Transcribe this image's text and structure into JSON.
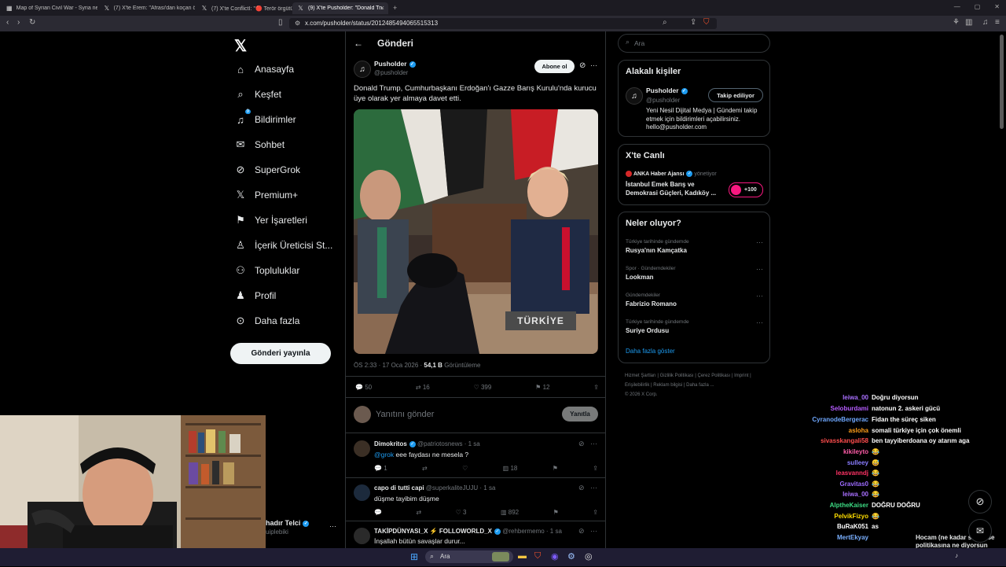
{
  "browser": {
    "tabs": [
      {
        "label": "Map of Syrian Civil War - Syria news ...",
        "icon": "map-icon"
      },
      {
        "label": "(7) X'te Erem: \"Afrasi'dan koçan örgüt...",
        "icon": "x-icon"
      },
      {
        "label": "(7) X'te ConflictI: \"🔴 Terör örgütü P...",
        "icon": "x-icon"
      },
      {
        "label": "(9) X'te Pusholder: \"Donald Trum...",
        "icon": "x-icon"
      }
    ],
    "url": "x.com/pusholder/status/2012485494065515313"
  },
  "sidebar": {
    "items": [
      {
        "label": "Anasayfa",
        "icon": "home-icon"
      },
      {
        "label": "Keşfet",
        "icon": "search-icon"
      },
      {
        "label": "Bildirimler",
        "icon": "bell-icon",
        "badge": "9"
      },
      {
        "label": "Sohbet",
        "icon": "mail-icon"
      },
      {
        "label": "SuperGrok",
        "icon": "grok-icon"
      },
      {
        "label": "Premium+",
        "icon": "x-icon"
      },
      {
        "label": "Yer İşaretleri",
        "icon": "bookmark-icon"
      },
      {
        "label": "İçerik Üreticisi St...",
        "icon": "creator-icon"
      },
      {
        "label": "Topluluklar",
        "icon": "community-icon"
      },
      {
        "label": "Profil",
        "icon": "profile-icon"
      },
      {
        "label": "Daha fazla",
        "icon": "more-icon"
      }
    ],
    "post_button": "Gönderi yayınla",
    "account_name": "hadır Telci",
    "account_handle": "uiplebiki"
  },
  "main": {
    "header": "Gönderi",
    "post": {
      "author": "Pusholder",
      "handle": "@pusholder",
      "follow_label": "Abone ol",
      "text": "Donald Trump, Cumhurbaşkanı Erdoğan'ı Gazze Barış Kurulu'nda kurucu üye olarak yer almaya davet etti.",
      "image_caption": "TÜRKİYE",
      "time": "ÖS 2:33 · 17 Oca 2026 · ",
      "views": "54,1 B",
      "views_label": " Görüntüleme",
      "stats": {
        "replies": "50",
        "reposts": "16",
        "likes": "399",
        "bookmarks": "12"
      }
    },
    "reply_box": {
      "placeholder": "Yanıtını gönder",
      "button": "Yanıtla"
    },
    "replies": [
      {
        "author": "Dimokritos",
        "handle": "@patriotosnews · 1 sa",
        "mention": "@grok",
        "text": " eee faydası ne mesela ?",
        "replies": "1",
        "likes": "",
        "views": "18"
      },
      {
        "author": "capo di tutti capi",
        "handle": "@superkaliteJUJU · 1 sa",
        "mention": "",
        "text": "düşme tayibim düşme",
        "replies": "",
        "likes": "3",
        "views": "892"
      },
      {
        "author": "TAKİPDÜNYASI_X ⚡ FOLLOWORLD_X",
        "handle": "@rehbermemo · 1 sa",
        "mention": "",
        "text": "İnşallah bütün savaşlar durur...",
        "replies": "",
        "likes": "",
        "views": ""
      }
    ]
  },
  "right": {
    "search_placeholder": "Ara",
    "related": {
      "title": "Alakalı kişiler",
      "name": "Pusholder",
      "handle": "@pusholder",
      "follow_label": "Takip ediliyor",
      "bio": "Yeni Nesil Dijital Medya | Gündemi takip etmek için bildirimleri açabilirsiniz. hello@pusholder.com"
    },
    "live": {
      "title": "X'te Canlı",
      "host": "ANKA Haber Ajansı",
      "host_suffix": "yönetiyor",
      "topic": "İstanbul Emek Barış ve Demokrasi Güçleri, Kadıköy ...",
      "count": "+100"
    },
    "trends": {
      "title": "Neler oluyor?",
      "items": [
        {
          "category": "Türkiye tarihinde gündemde",
          "name": "Rusya'nın Kamçatka"
        },
        {
          "category": "Spor · Gündemdekiler",
          "name": "Lookman"
        },
        {
          "category": "Gündemdekiler",
          "name": "Fabrizio Romano"
        },
        {
          "category": "Türkiye tarihinde gündemde",
          "name": "Suriye Ordusu"
        }
      ],
      "show_more": "Daha fazla göster"
    },
    "footer": [
      "Hizmet Şartları",
      "Gizlilik Politikası",
      "Çerez Politikası",
      "Imprint",
      "Erişilebilirlik",
      "Reklam bilgisi",
      "Daha fazla ...",
      "© 2026 X Corp."
    ]
  },
  "chat": [
    {
      "user": "leiwa_00",
      "color": "#a970ff",
      "msg": "Doğru diyorsun"
    },
    {
      "user": "Seloburdami",
      "color": "#b65cff",
      "msg": "natonun 2. askeri gücü"
    },
    {
      "user": "CyranodeBergerac",
      "color": "#6fa8ff",
      "msg": "Fidan the süreç siken"
    },
    {
      "user": "asloha",
      "color": "#ff9f1a",
      "msg": "somali türkiye için çok önemli"
    },
    {
      "user": "sivasskangali58",
      "color": "#ff4d4d",
      "msg": "ben tayyiberdoana oy atarım aga"
    },
    {
      "user": "kikileyto",
      "color": "#ff5ca8",
      "msg": "😂"
    },
    {
      "user": "sulleey",
      "color": "#8a7dff",
      "msg": "😅"
    },
    {
      "user": "leasvanndj",
      "color": "#ff3366",
      "msg": "😂"
    },
    {
      "user": "Gravitas0",
      "color": "#9d6bff",
      "msg": "😂"
    },
    {
      "user": "leiwa_00",
      "color": "#a970ff",
      "msg": "😂"
    },
    {
      "user": "AlptheKaiser",
      "color": "#3ddc84",
      "msg": "DOĞRU DOĞRU"
    },
    {
      "user": "PelvikFizyo",
      "color": "#ffde00",
      "msg": "😂"
    },
    {
      "user": "BuRaK051",
      "color": "#ffffff",
      "msg": "as"
    },
    {
      "user": "MertEkyay",
      "color": "#7ab0ff",
      "msg": ""
    }
  ],
  "overlay_caption": "Hocam (ne kadar sevmese politikasına ne diyorsun beyefendi"
}
